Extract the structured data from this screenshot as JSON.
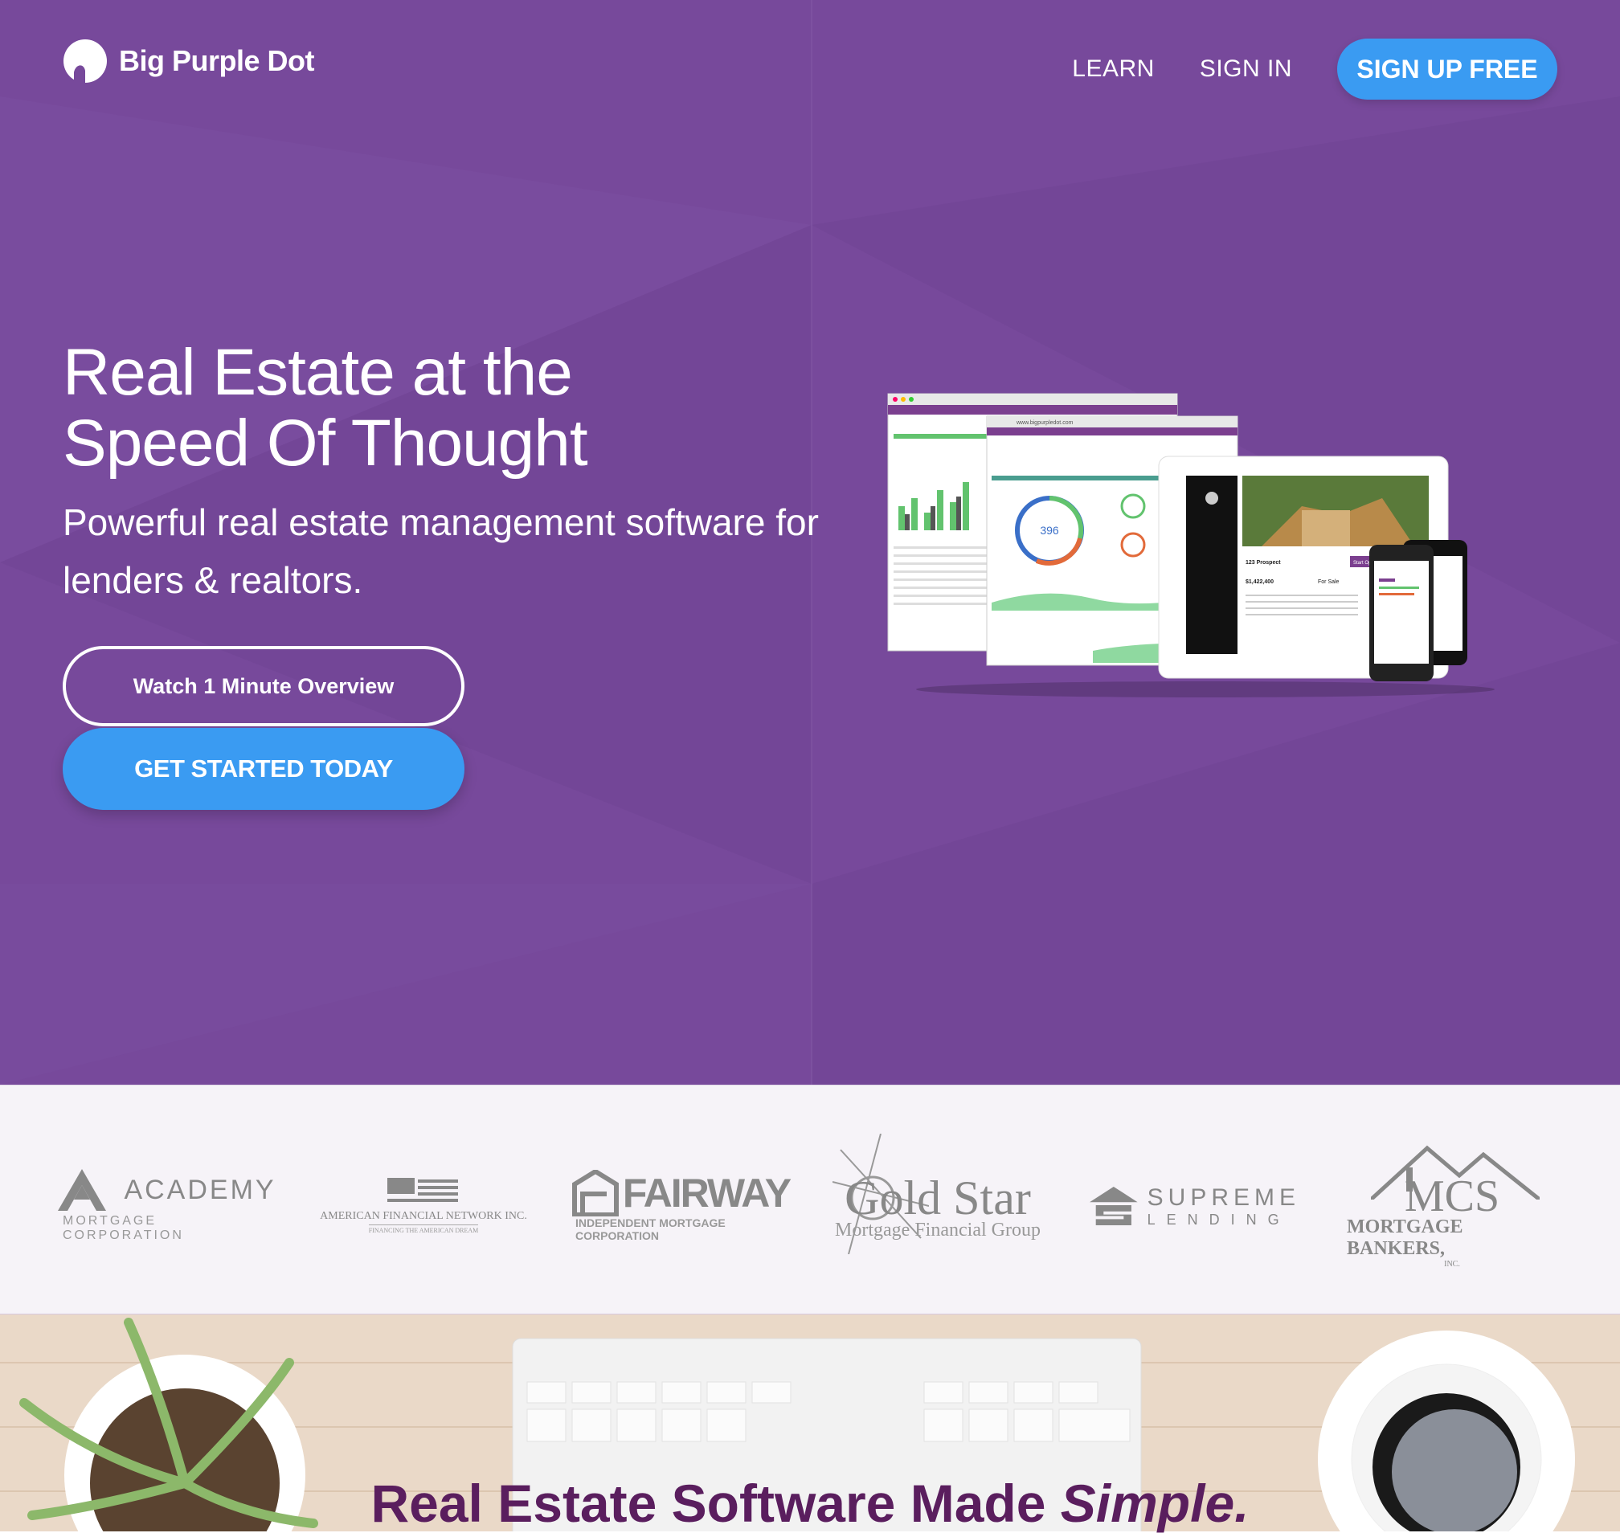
{
  "nav": {
    "brand": "Big Purple Dot",
    "links": [
      "LEARN",
      "SIGN IN"
    ],
    "cta": "SIGN UP FREE"
  },
  "hero": {
    "headline_line1": "Real Estate at the",
    "headline_line2": "Speed Of Thought",
    "subheadline": "Powerful real estate management software for lenders & realtors.",
    "overview_button": "Watch 1 Minute Overview",
    "start_button": "GET STARTED TODAY",
    "dashboard_value": "396",
    "listing_address": "123 Prospect",
    "listing_price": "$1,422,400",
    "listing_status": "For Sale",
    "open_house_label": "Start Open House",
    "url": "www.bigpurpledot.com"
  },
  "partners": {
    "academy": {
      "name": "ACADEMY",
      "sub": "MORTGAGE CORPORATION"
    },
    "american": {
      "name": "AMERICAN FINANCIAL NETWORK INC.",
      "sub": "FINANCING THE AMERICAN DREAM"
    },
    "fairway": {
      "name": "FAIRWAY",
      "sub": "INDEPENDENT MORTGAGE CORPORATION"
    },
    "goldstar": {
      "name": "Gold Star",
      "sub": "Mortgage Financial Group"
    },
    "supreme": {
      "name": "SUPREME",
      "sub": "LENDING"
    },
    "mcs": {
      "name": "MCS",
      "sub": "MORTGAGE BANKERS,",
      "sub2": "INC."
    }
  },
  "section2": {
    "title_plain": "Real Estate Software Made ",
    "title_em": "Simple."
  },
  "colors": {
    "purple": "#77499b",
    "blue": "#3a9bf2",
    "dark_purple": "#5a1e5e"
  }
}
